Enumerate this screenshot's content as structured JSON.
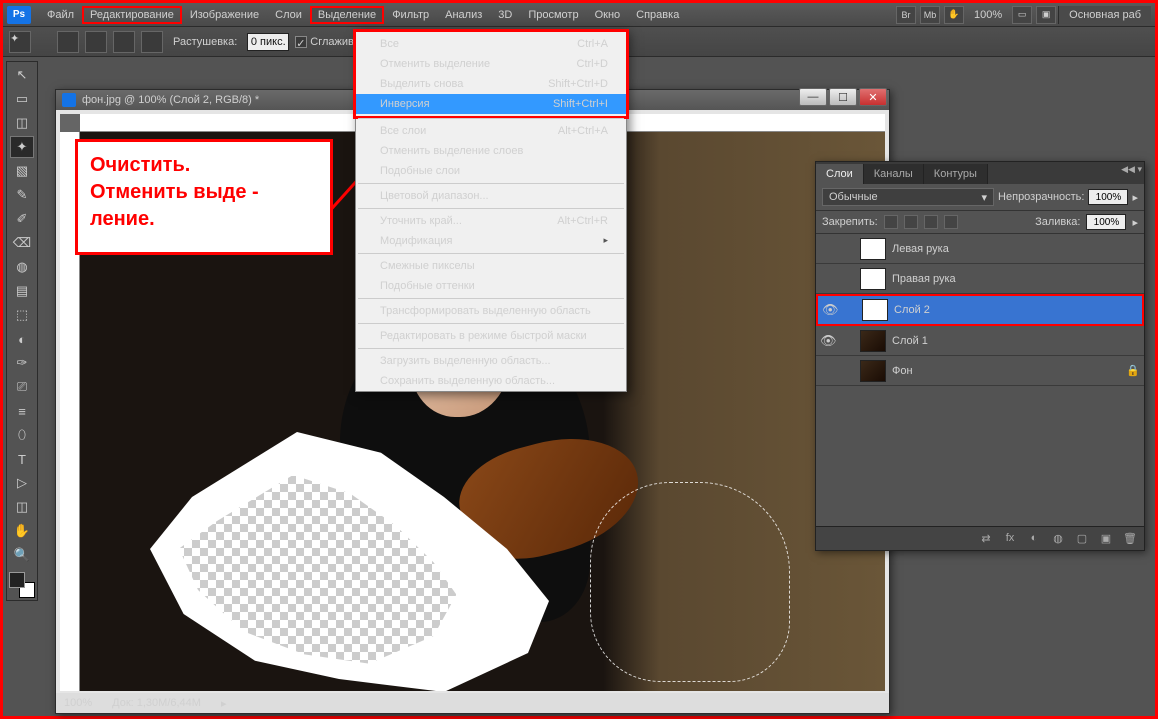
{
  "menubar": {
    "items": [
      "Файл",
      "Редактирование",
      "Изображение",
      "Слои",
      "Выделение",
      "Фильтр",
      "Анализ",
      "3D",
      "Просмотр",
      "Окно",
      "Справка"
    ],
    "zoom": "100%",
    "workspace": "Основная раб"
  },
  "optbar": {
    "feather_label": "Растушевка:",
    "feather_value": "0 пикс.",
    "smooth_label": "Сглаживан"
  },
  "doc": {
    "title": "фон.jpg @ 100% (Слой 2, RGB/8) *",
    "zoom": "100%",
    "docinfo": "Док: 1,30M/6,44M"
  },
  "annotation": {
    "l1": "Очистить.",
    "l2": "Отменить выде -",
    "l3": "ление."
  },
  "dropdown": {
    "groups": [
      [
        {
          "label": "Все",
          "short": "Ctrl+A"
        },
        {
          "label": "Отменить выделение",
          "short": "Ctrl+D"
        },
        {
          "label": "Выделить снова",
          "short": "Shift+Ctrl+D"
        },
        {
          "label": "Инверсия",
          "short": "Shift+Ctrl+I",
          "hl": true
        }
      ],
      [
        {
          "label": "Все слои",
          "short": "Alt+Ctrl+A"
        },
        {
          "label": "Отменить выделение слоев",
          "short": ""
        },
        {
          "label": "Подобные слои",
          "short": ""
        }
      ],
      [
        {
          "label": "Цветовой диапазон...",
          "short": ""
        }
      ],
      [
        {
          "label": "Уточнить край...",
          "short": "Alt+Ctrl+R"
        },
        {
          "label": "Модификация",
          "short": "",
          "arrow": true
        }
      ],
      [
        {
          "label": "Смежные пикселы",
          "short": ""
        },
        {
          "label": "Подобные оттенки",
          "short": ""
        }
      ],
      [
        {
          "label": "Трансформировать выделенную область",
          "short": ""
        }
      ],
      [
        {
          "label": "Редактировать в режиме быстрой маски",
          "short": ""
        }
      ],
      [
        {
          "label": "Загрузить выделенную область...",
          "short": ""
        },
        {
          "label": "Сохранить выделенную область...",
          "short": ""
        }
      ]
    ]
  },
  "layers": {
    "tabs": [
      "Слои",
      "Каналы",
      "Контуры"
    ],
    "blend": "Обычные",
    "opacity_label": "Непрозрачность:",
    "opacity_value": "100%",
    "lock_label": "Закрепить:",
    "fill_label": "Заливка:",
    "fill_value": "100%",
    "items": [
      {
        "name": "Левая рука",
        "vis": false,
        "thumb": "checker"
      },
      {
        "name": "Правая рука",
        "vis": false,
        "thumb": "checker"
      },
      {
        "name": "Слой 2",
        "vis": true,
        "thumb": "checker",
        "sel": true
      },
      {
        "name": "Слой 1",
        "vis": true,
        "thumb": "dark"
      },
      {
        "name": "Фон",
        "vis": false,
        "thumb": "dark",
        "lock": true
      }
    ]
  },
  "tools": [
    "↖",
    "▭",
    "◫",
    "✦",
    "▧",
    "✎",
    "✐",
    "⌫",
    "◍",
    "▤",
    "⬚",
    "◐",
    "✑",
    "⎚",
    "≡",
    "⬯",
    "T",
    "▷",
    "◫",
    "✋",
    "🔍"
  ]
}
